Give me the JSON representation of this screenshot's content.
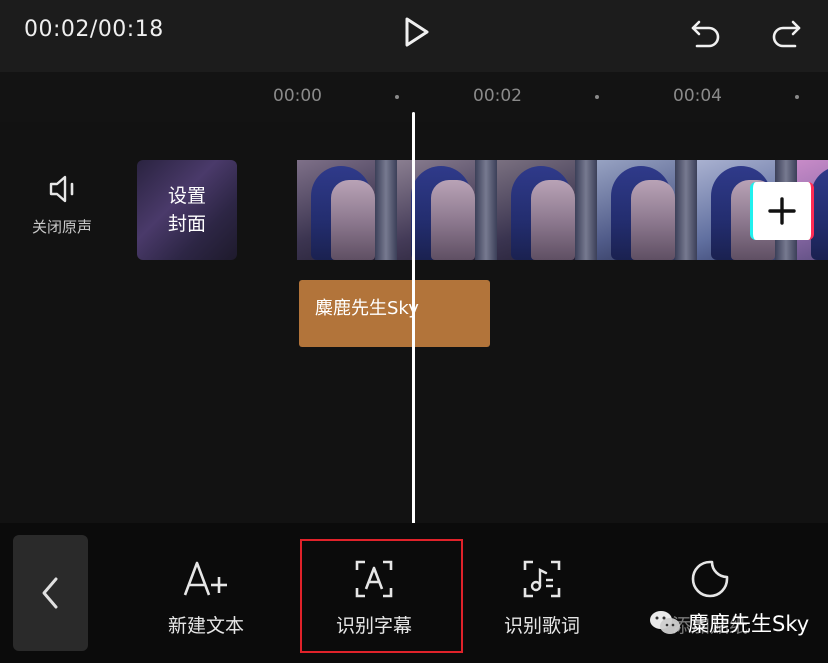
{
  "header": {
    "timecode": "00:02/00:18"
  },
  "ruler": {
    "labels": [
      "00:00",
      "00:02",
      "00:04"
    ]
  },
  "track": {
    "mute_label": "关闭原声",
    "cover_label_line1": "设置",
    "cover_label_line2": "封面",
    "text_clip_label": "麋鹿先生Sky"
  },
  "toolbar": {
    "tools": [
      {
        "label": "新建文本",
        "icon": "text-add-icon"
      },
      {
        "label": "识别字幕",
        "icon": "recognize-subtitle-icon",
        "highlighted": true
      },
      {
        "label": "识别歌词",
        "icon": "recognize-lyrics-icon"
      },
      {
        "label": "添加贴纸",
        "icon": "sticker-icon"
      }
    ]
  },
  "watermark": {
    "text": "麋鹿先生Sky"
  },
  "colors": {
    "text_clip": "#b2743a",
    "highlight_border": "#e0222a",
    "background": "#121212"
  }
}
